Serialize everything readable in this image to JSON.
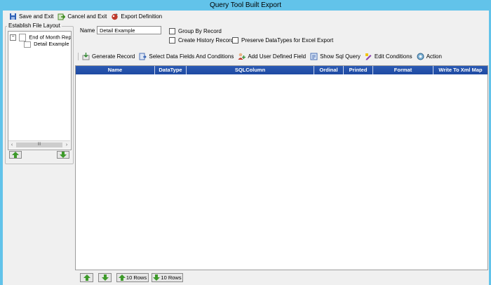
{
  "window": {
    "title": "Query Tool Built Export"
  },
  "toolbar": {
    "save_exit": "Save and Exit",
    "cancel_exit": "Cancel and Exit",
    "export_def": "Export Definition"
  },
  "sidebar": {
    "group_title": "Establish File Layout",
    "tree": [
      {
        "label": "End of Month Repor",
        "expander": "⊟"
      },
      {
        "label": "Detail Example"
      }
    ],
    "scroll_mid": "III"
  },
  "form": {
    "name_label": "Name",
    "name_value": "Detail Example",
    "group_by": "Group By Record",
    "create_history": "Create History Record",
    "preserve_types": "Preserve DataTypes for Excel Export"
  },
  "actions": {
    "generate": "Generate Record",
    "select_fields": "Select Data Fields And Conditions",
    "add_udf": "Add User Defined Field",
    "show_sql": "Show Sql Query",
    "edit_cond": "Edit Conditions",
    "action": "Action"
  },
  "grid": {
    "columns": [
      "Name",
      "DataType",
      "SQLColumn",
      "Ordinal",
      "Printed",
      "Format",
      "Write To Xml Map"
    ]
  },
  "bottom": {
    "up10": "10 Rows",
    "down10": "10 Rows"
  },
  "colors": {
    "title": "#62c3ea",
    "grid_header": "#1f4aa2"
  },
  "icons": [
    "save-icon",
    "cancel-icon",
    "export-icon",
    "generate-icon",
    "select-fields-icon",
    "add-field-icon",
    "sql-icon",
    "edit-conditions-icon",
    "action-icon",
    "up-arrow-icon",
    "down-arrow-icon"
  ]
}
